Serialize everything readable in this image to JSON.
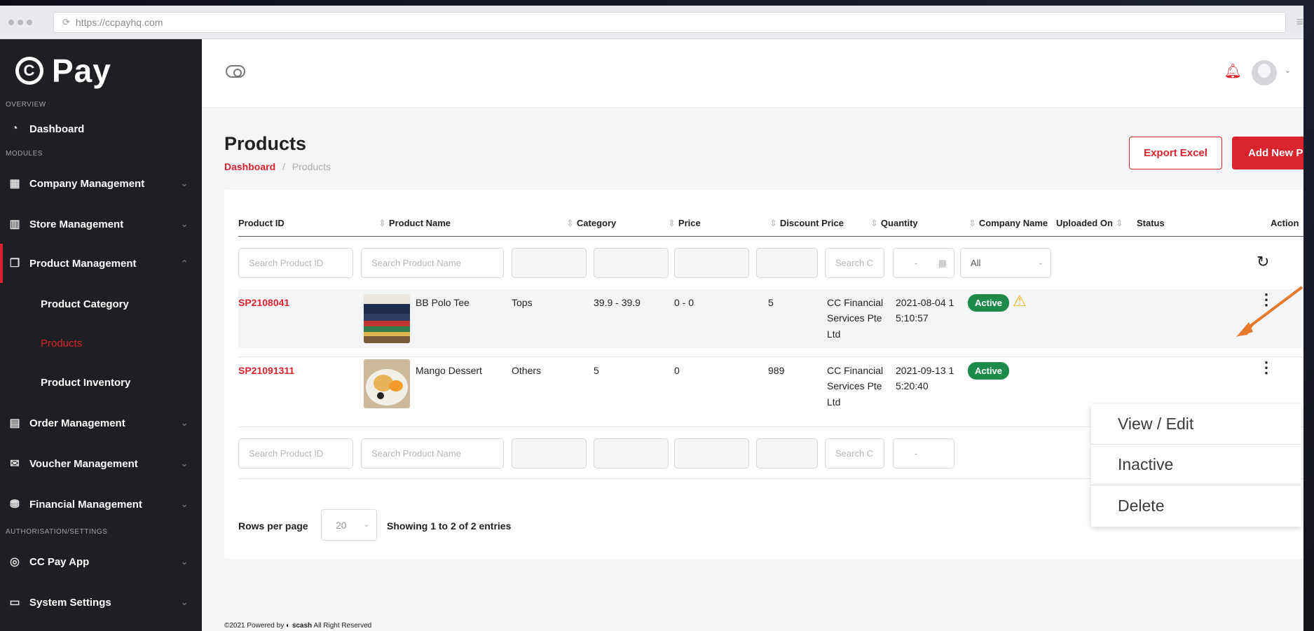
{
  "browser": {
    "url": "https://ccpayhq.com"
  },
  "brand": {
    "mark": "C",
    "name": "Pay"
  },
  "sidebar": {
    "sections": [
      "OVERVIEW",
      "MODULES",
      "AUTHORISATION/SETTINGS"
    ],
    "dashboard": "Dashboard",
    "items": [
      {
        "label": "Company Management"
      },
      {
        "label": "Store Management"
      },
      {
        "label": "Product Management"
      },
      {
        "label": "Order Management"
      },
      {
        "label": "Voucher Management"
      },
      {
        "label": "Financial Management"
      },
      {
        "label": "CC Pay App"
      },
      {
        "label": "System Settings"
      }
    ],
    "sub_items": [
      {
        "label": "Product Category"
      },
      {
        "label": "Products"
      },
      {
        "label": "Product Inventory"
      }
    ]
  },
  "page": {
    "title": "Products",
    "breadcrumb": {
      "home": "Dashboard",
      "sep": "/",
      "current": "Products"
    },
    "export_label": "Export Excel",
    "add_label": "Add New Product"
  },
  "table": {
    "columns": [
      "Product ID",
      "Product Name",
      "Category",
      "Price",
      "Discount Price",
      "Quantity",
      "Company Name",
      "Uploaded On",
      "Status",
      "Action"
    ],
    "filters": {
      "product_id_placeholder": "Search Product ID",
      "product_name_placeholder": "Search Product Name",
      "company_placeholder": "Search C",
      "date_placeholder": "-",
      "status_value": "All"
    },
    "rows": [
      {
        "id": "SP2108041",
        "name": "BB Polo Tee",
        "category": "Tops",
        "price": "39.9 - 39.9",
        "discount": "0 - 0",
        "quantity": "5",
        "company": [
          "CC Financial",
          "Services Pte",
          "Ltd"
        ],
        "uploaded": [
          "2021-08-04 1",
          "5:10:57"
        ],
        "status": "Active"
      },
      {
        "id": "SP21091311",
        "name": "Mango Dessert",
        "category": "Others",
        "price": "5",
        "discount": "0",
        "quantity": "989",
        "company": [
          "CC Financial",
          "Services Pte",
          "Ltd"
        ],
        "uploaded": [
          "2021-09-13 1",
          "5:20:40"
        ],
        "status": "Active"
      }
    ]
  },
  "pagination": {
    "rows_per_page_label": "Rows per page",
    "rows_per_page": "20",
    "showing": "Showing 1 to 2 of 2 entries"
  },
  "action_menu": [
    "View / Edit",
    "Inactive",
    "Delete"
  ],
  "footer": "©2021 Powered by",
  "footer_brand": "scash",
  "footer_rest": "All Right Reserved",
  "colors": {
    "accent": "#d9232d",
    "active": "#1d8a4a",
    "warning": "#f3b31b",
    "sidebar": "#1e1f23"
  }
}
